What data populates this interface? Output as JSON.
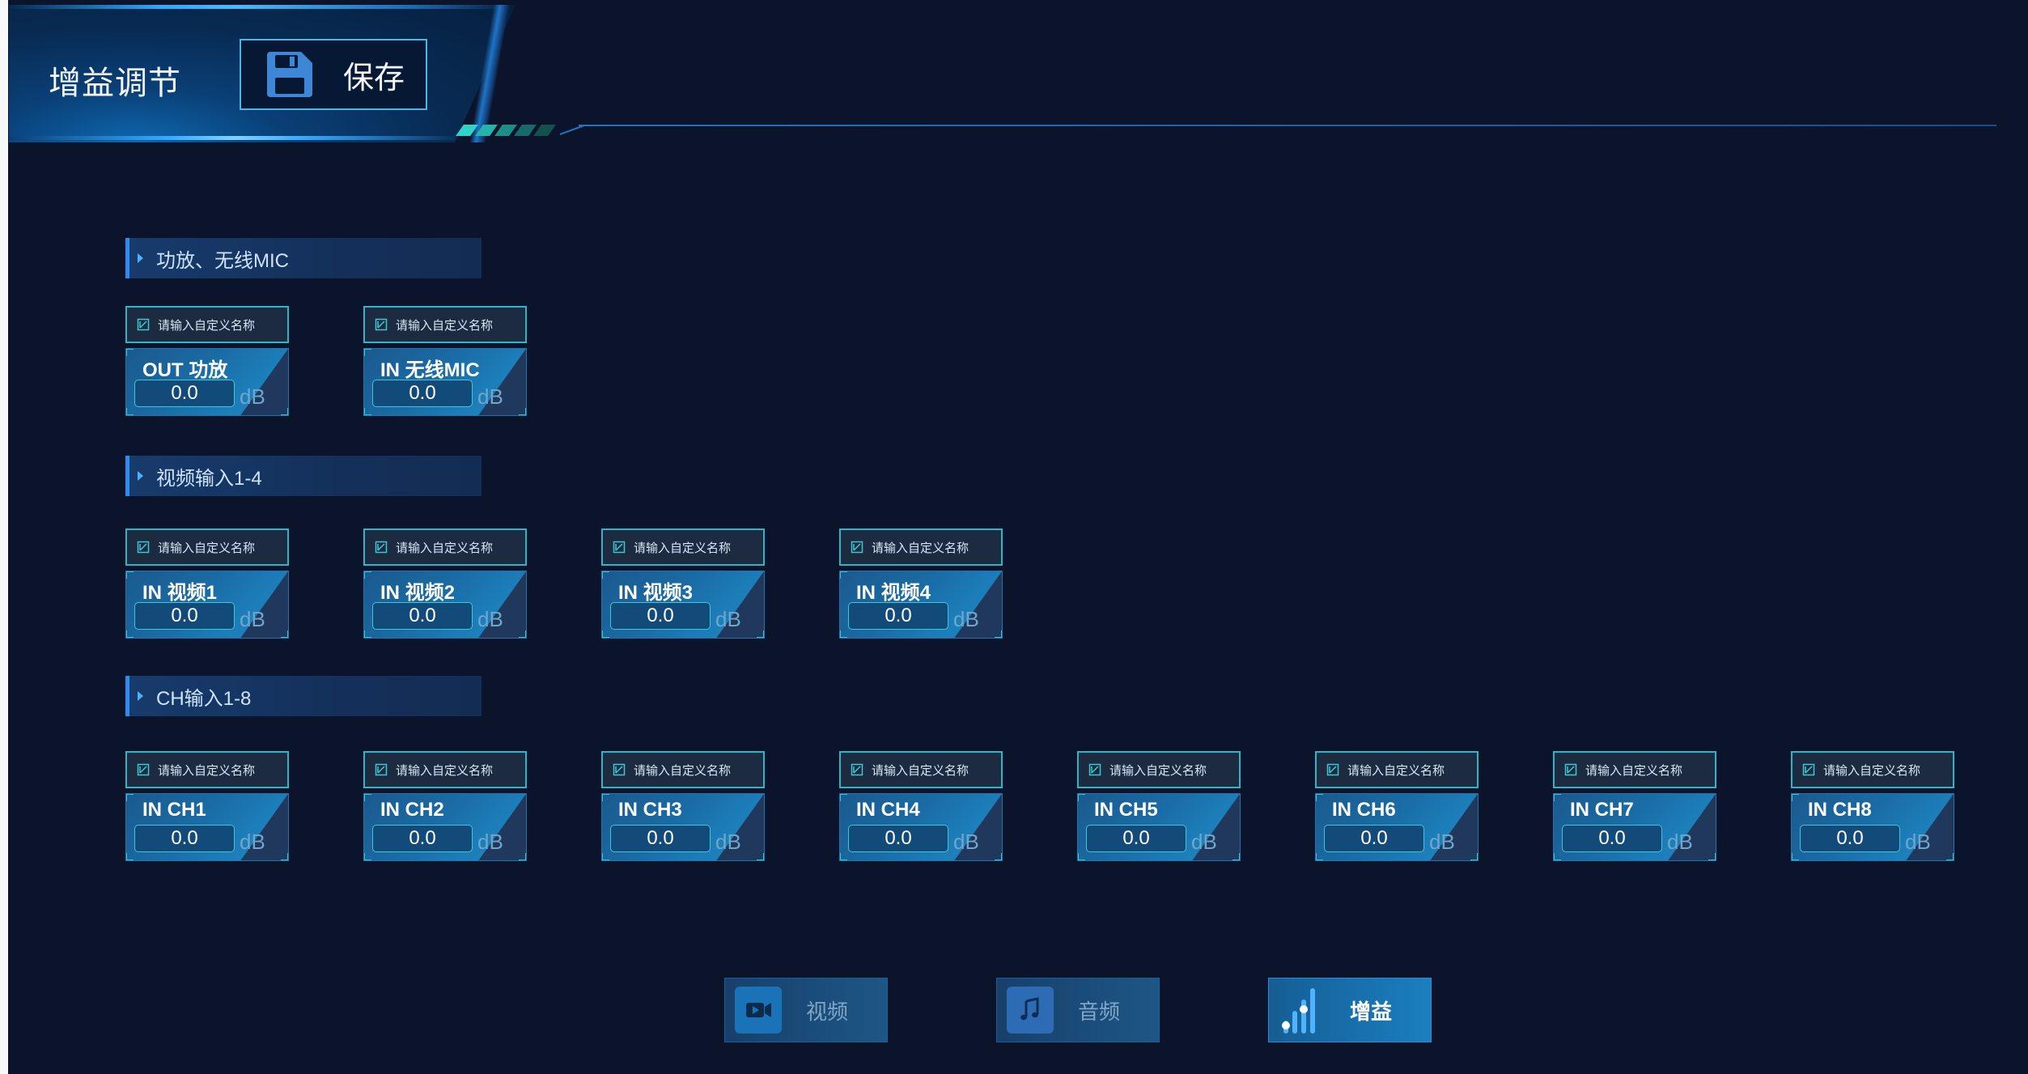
{
  "header": {
    "title": "增益调节",
    "save_label": "保存",
    "stripe_colors": [
      "#2fd3c7",
      "#24b3a8",
      "#1c8d87",
      "#166b6a",
      "#11524f"
    ]
  },
  "input_placeholder": "请输入自定义名称",
  "unit": "dB",
  "sections": [
    {
      "title": "功放、无线MIC",
      "channels": [
        {
          "label": "OUT 功放",
          "value": "0.0"
        },
        {
          "label": "IN 无线MIC",
          "value": "0.0"
        }
      ]
    },
    {
      "title": "视频输入1-4",
      "channels": [
        {
          "label": "IN 视频1",
          "value": "0.0"
        },
        {
          "label": "IN 视频2",
          "value": "0.0"
        },
        {
          "label": "IN 视频3",
          "value": "0.0"
        },
        {
          "label": "IN 视频4",
          "value": "0.0"
        }
      ]
    },
    {
      "title": "CH输入1-8",
      "channels": [
        {
          "label": "IN CH1",
          "value": "0.0"
        },
        {
          "label": "IN CH2",
          "value": "0.0"
        },
        {
          "label": "IN CH3",
          "value": "0.0"
        },
        {
          "label": "IN CH4",
          "value": "0.0"
        },
        {
          "label": "IN CH5",
          "value": "0.0"
        },
        {
          "label": "IN CH6",
          "value": "0.0"
        },
        {
          "label": "IN CH7",
          "value": "0.0"
        },
        {
          "label": "IN CH8",
          "value": "0.0"
        }
      ]
    }
  ],
  "bottom_nav": [
    {
      "label": "视频",
      "icon": "video-camera-icon",
      "active": false
    },
    {
      "label": "音频",
      "icon": "music-note-icon",
      "active": false
    },
    {
      "label": "增益",
      "icon": "gain-bars-icon",
      "active": true
    }
  ],
  "colors": {
    "background": "#0c142b",
    "accent": "#2fb5c9",
    "save_border": "#48b6e8"
  }
}
